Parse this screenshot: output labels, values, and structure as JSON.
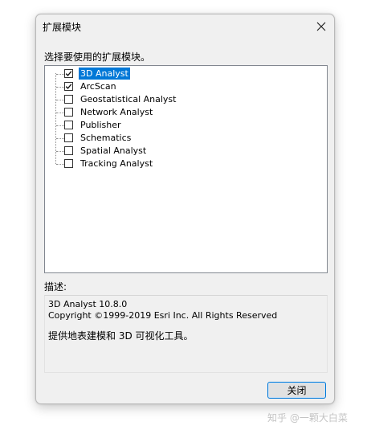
{
  "window": {
    "title": "扩展模块",
    "close_glyph": "✕"
  },
  "instruction": "选择要使用的扩展模块。",
  "extensions": [
    {
      "label": "3D Analyst",
      "checked": true,
      "selected": true
    },
    {
      "label": "ArcScan",
      "checked": true,
      "selected": false
    },
    {
      "label": "Geostatistical Analyst",
      "checked": false,
      "selected": false
    },
    {
      "label": "Network Analyst",
      "checked": false,
      "selected": false
    },
    {
      "label": "Publisher",
      "checked": false,
      "selected": false
    },
    {
      "label": "Schematics",
      "checked": false,
      "selected": false
    },
    {
      "label": "Spatial Analyst",
      "checked": false,
      "selected": false
    },
    {
      "label": "Tracking Analyst",
      "checked": false,
      "selected": false
    }
  ],
  "description": {
    "label": "描述:",
    "name_version": "3D Analyst 10.8.0",
    "copyright": "Copyright ©1999-2019 Esri Inc. All Rights Reserved",
    "text": "提供地表建模和 3D 可视化工具。"
  },
  "buttons": {
    "close_label": "关闭"
  },
  "watermark": "知乎 @一颗大白菜"
}
